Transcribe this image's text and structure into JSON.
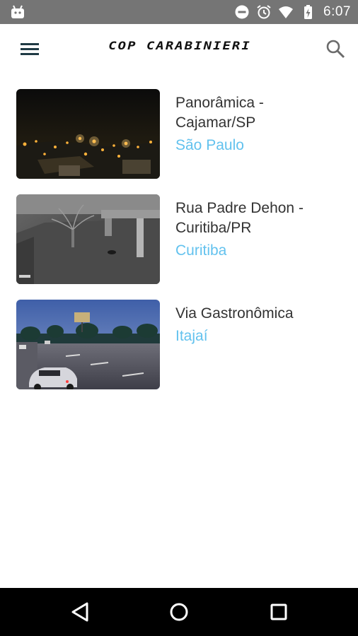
{
  "status_bar": {
    "time": "6:07",
    "icons": [
      "android-icon",
      "do-not-disturb-icon",
      "alarm-icon",
      "wifi-icon",
      "battery-charging-icon"
    ]
  },
  "app_bar": {
    "title": "COP CARABINIERI",
    "menu_icon": "hamburger-menu-icon",
    "search_icon": "search-icon"
  },
  "colors": {
    "city_link": "#63c2ee",
    "title_text": "#333333",
    "status_bar": "#757575",
    "nav_bar": "#000000"
  },
  "cameras": [
    {
      "title": "Panorâmica - Cajamar/SP",
      "city": "São Paulo",
      "thumbnail": "night-city-panorama"
    },
    {
      "title": "Rua Padre Dehon - Curitiba/PR",
      "city": "Curitiba",
      "thumbnail": "night-street-camera"
    },
    {
      "title": "Via Gastronômica",
      "city": "Itajaí",
      "thumbnail": "dusk-avenue-with-cars"
    }
  ],
  "nav_bar": {
    "buttons": [
      "back-icon",
      "home-icon",
      "recents-icon"
    ]
  }
}
